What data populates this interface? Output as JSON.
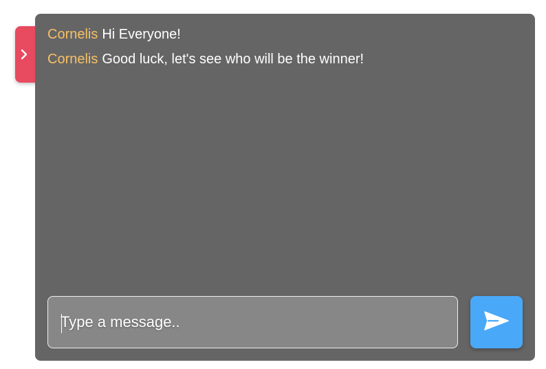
{
  "colors": {
    "panel_background": "#656565",
    "author_name": "#f7c066",
    "collapse_tab": "#e84a5f",
    "send_button": "#4aa8f8",
    "input_background": "#878787"
  },
  "sidebar_toggle": {
    "icon": "chevron-right-icon"
  },
  "messages": [
    {
      "author": "Cornelis",
      "text": "Hi Everyone!"
    },
    {
      "author": "Cornelis",
      "text": "Good luck, let's see who will be the winner!"
    }
  ],
  "composer": {
    "value": "",
    "placeholder": "Type a message..",
    "send_icon": "send-icon"
  }
}
